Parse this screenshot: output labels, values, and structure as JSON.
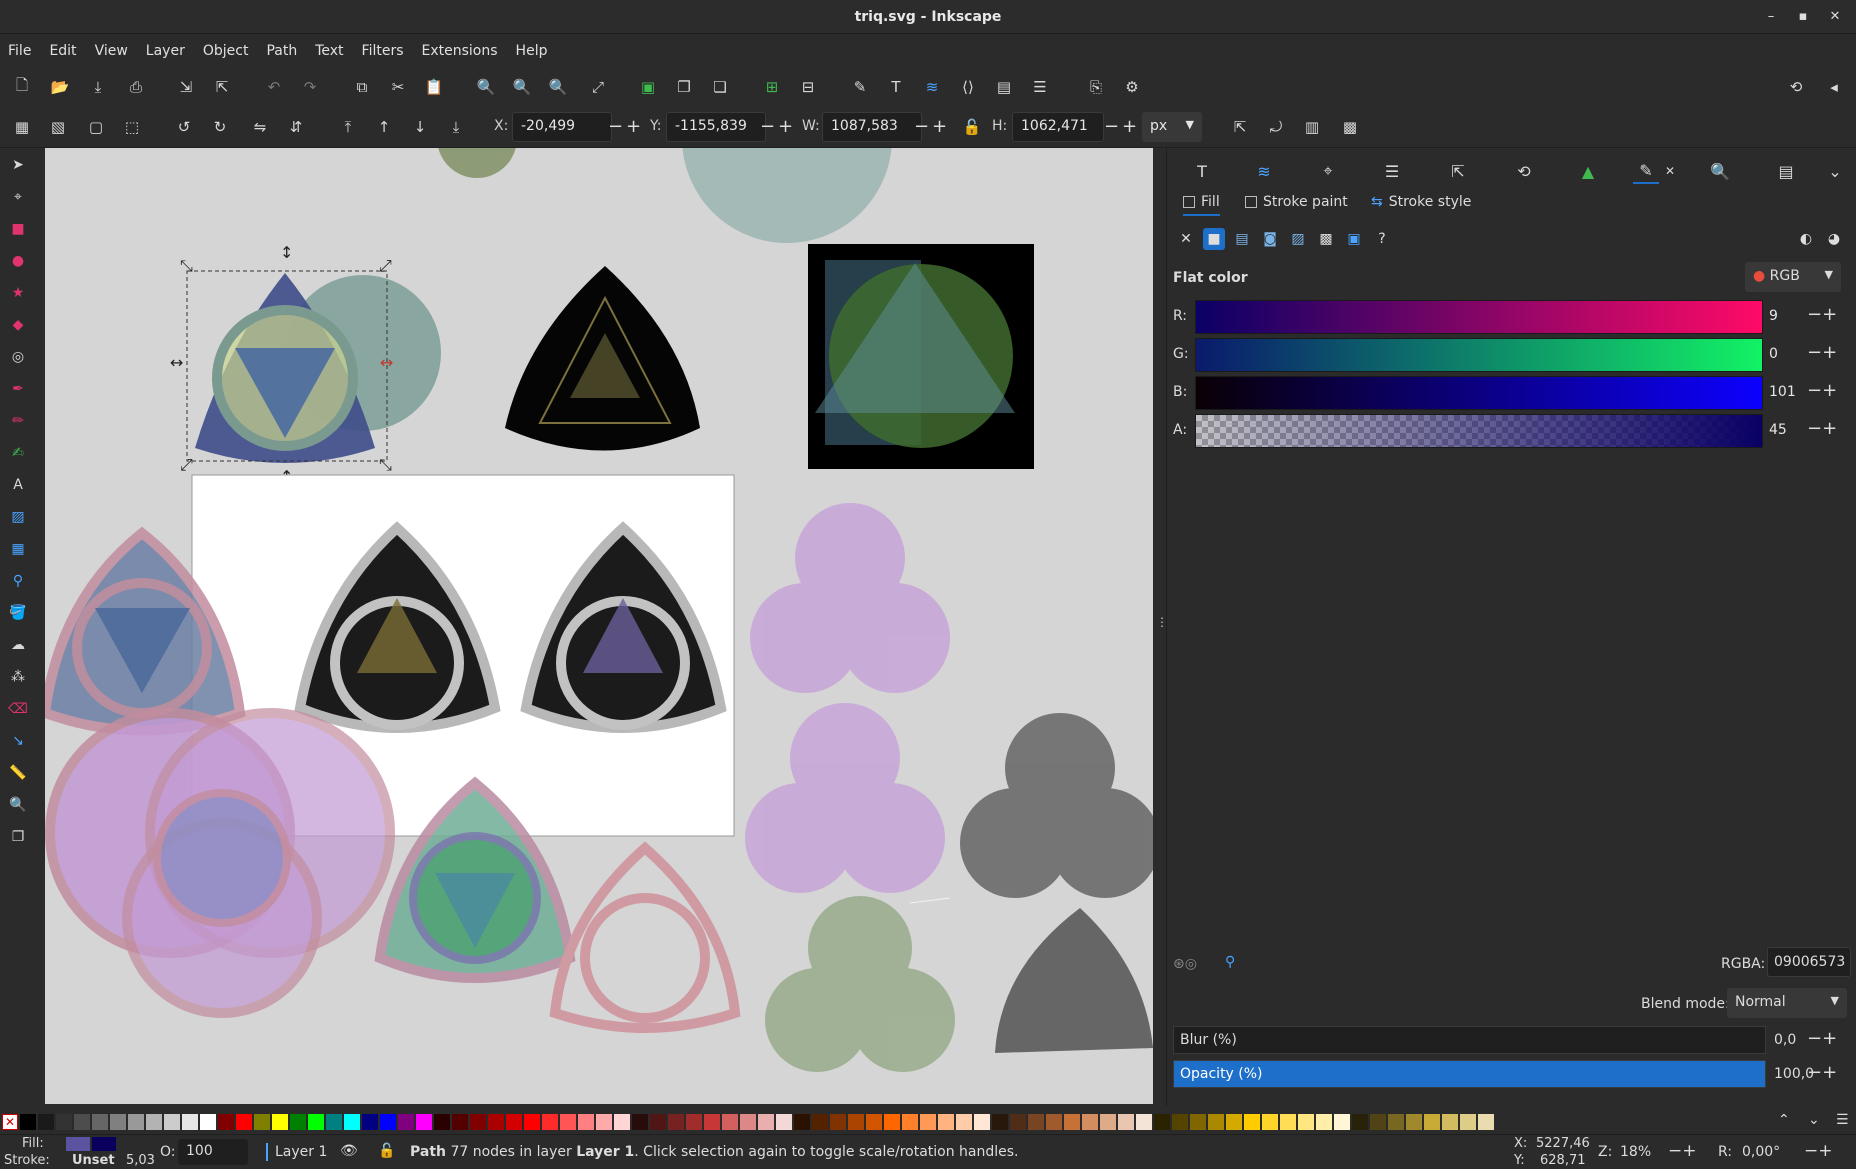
{
  "window": {
    "title": "triq.svg - Inkscape"
  },
  "menu": [
    "File",
    "Edit",
    "View",
    "Layer",
    "Object",
    "Path",
    "Text",
    "Filters",
    "Extensions",
    "Help"
  ],
  "toolcontrols": {
    "x_label": "X:",
    "x_value": "-20,499",
    "y_label": "Y:",
    "y_value": "-1155,839",
    "w_label": "W:",
    "w_value": "1087,583",
    "h_label": "H:",
    "h_value": "1062,471",
    "unit": "px"
  },
  "fillstroke": {
    "tabs": {
      "fill": "Fill",
      "stroke_paint": "Stroke paint",
      "stroke_style": "Stroke style"
    },
    "mode_title": "Flat color",
    "color_model": "RGB",
    "channels": [
      {
        "label": "R:",
        "value": "9"
      },
      {
        "label": "G:",
        "value": "0"
      },
      {
        "label": "B:",
        "value": "101"
      },
      {
        "label": "A:",
        "value": "45"
      }
    ],
    "rgba_label": "RGBA:",
    "rgba_value": "09006573",
    "blend_label": "Blend mode:",
    "blend_value": "Normal",
    "blur_label": "Blur (%)",
    "blur_value": "0,0",
    "opacity_label": "Opacity (%)",
    "opacity_value": "100,0",
    "opacity_level": 1.0
  },
  "status": {
    "fill_label": "Fill:",
    "stroke_label": "Stroke:",
    "stroke_value": "Unset",
    "stroke_width": "5,03",
    "opacity_label": "O:",
    "opacity_value": "100",
    "layer": "Layer 1",
    "message_prefix": "Path",
    "message_body": "77 nodes in layer",
    "message_layer": "Layer 1",
    "message_suffix": ". Click selection again to toggle scale/rotation handles.",
    "cursor_x_label": "X:",
    "cursor_x": "5227,46",
    "cursor_y_label": "Y:",
    "cursor_y": "628,71",
    "zoom_label": "Z:",
    "zoom": "18%",
    "rotation_label": "R:",
    "rotation": "0,00°"
  },
  "colors": {
    "accent": "#1e6fc9",
    "fill_swatch": "#09006573",
    "canvas_bg": "#d5d5d5"
  }
}
